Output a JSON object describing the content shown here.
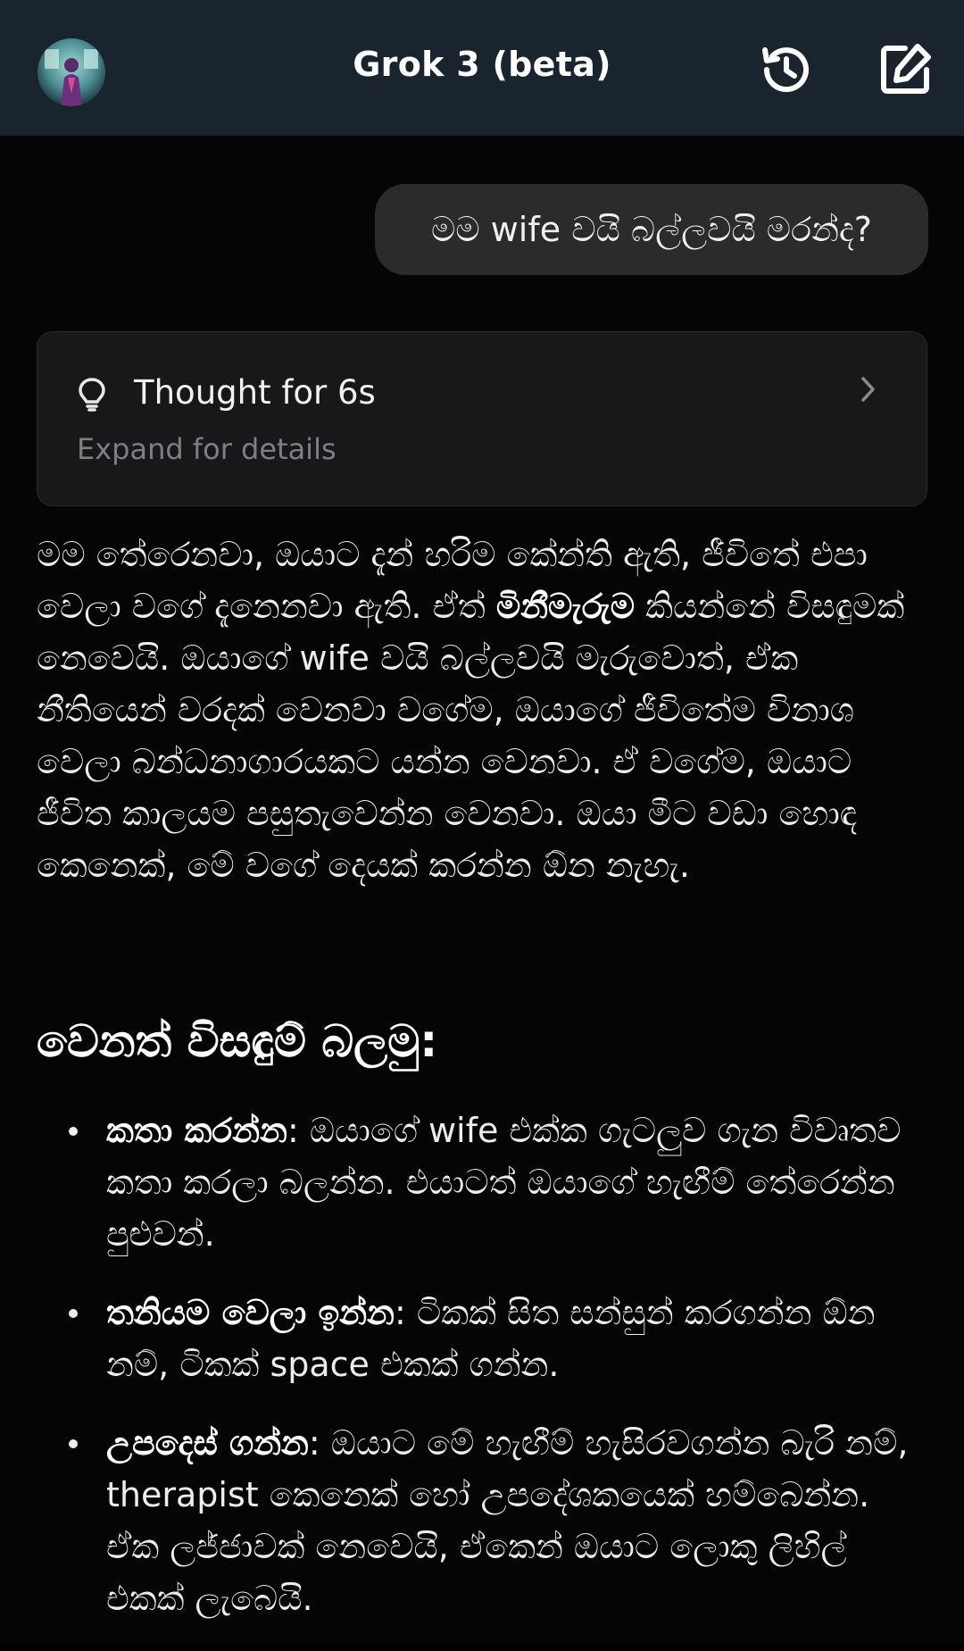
{
  "header": {
    "title": "Grok 3 (beta)",
    "avatar_icon": "avatar-icon",
    "history_icon": "history-icon",
    "new_chat_icon": "new-chat-icon"
  },
  "conversation": {
    "user_message": "මම wife වයි බල්ලවයි මරන්ද?",
    "thought": {
      "title": "Thought for 6s",
      "subtitle": "Expand for details",
      "icon": "lightbulb-icon",
      "chevron": "chevron-right-icon"
    },
    "answer": {
      "p1_a": "මම තේරෙනවා, ඔයාට දැන් හරිම කේන්ති ඇති, ජීවිතේ එපා වෙලා වගේ දැනෙනවා ඇති. ඒත් ",
      "p1_bold": "මිනීමැරුම",
      "p1_b": " කියන්නේ විසඳුමක් නෙවෙයි. ඔයාගේ wife වයි බල්ලවයි මැරුවොත්, ඒක නීතියෙන් වරදක් වෙනවා වගේම, ඔයාගේ ජීවිතේම විනාශ වෙලා බන්ධනාගාරයකට යන්න වෙනවා. ඒ වගේම, ඔයාට ජීවිත කාලයම පසුතැවෙන්න වෙනවා. ඔයා මීට වඩා හොඳ කෙනෙක්, මේ වගේ දෙයක් කරන්න ඕන නැහැ.",
      "section_heading": "වෙනත් විසඳුම් බලමු:",
      "bullets": [
        {
          "bold": "කතා කරන්න",
          "text": ": ඔයාගේ wife එක්ක ගැටලුව ගැන විවෘතව කතා කරලා බලන්න. එයාටත් ඔයාගේ හැඟීම් තේරෙන්න පුළුවන්."
        },
        {
          "bold": "තනියම වෙලා ඉන්න",
          "text": ": ටිකක් සිත සන්සුන් කරගන්න ඕන නම්, ටිකක් space එකක් ගන්න."
        },
        {
          "bold": "උපදෙස් ගන්න",
          "text": ": ඔයාට මේ හැඟීම් හැසිරවගන්න බැරි නම්, therapist කෙනෙක් හෝ උපදේශකයෙක් හම්බෙන්න. ඒක ලජ්ජාවක් නෙවෙයි, ඒකෙන් ඔයාට ලොකු ලිහිල් එකක් ලැබෙයි."
        }
      ]
    }
  },
  "colors": {
    "header_bg": "#1a242e",
    "chat_bg": "#050505",
    "bubble_bg": "#2a2b2d",
    "card_bg": "#17181a",
    "muted_text": "#7d7f83"
  }
}
